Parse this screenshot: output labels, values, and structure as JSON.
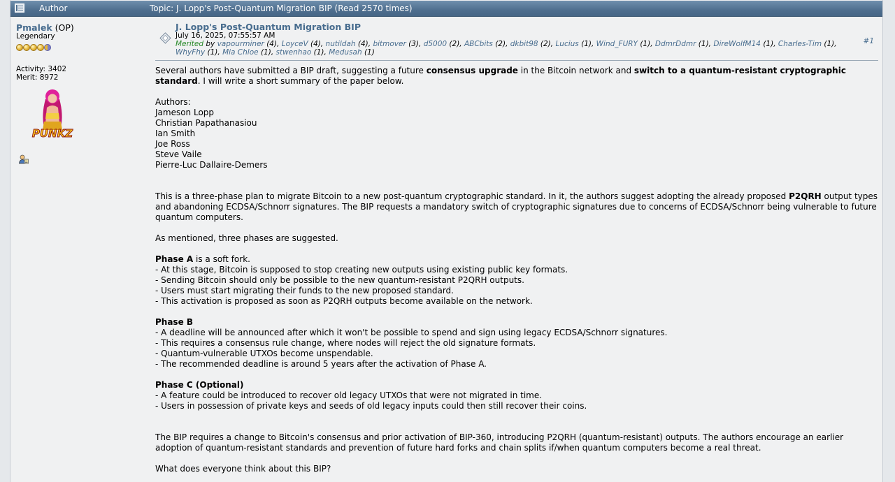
{
  "header": {
    "author_label": "Author",
    "topic_label": "Topic: J. Lopp's Post-Quantum Migration BIP  (Read 2570 times)"
  },
  "poster": {
    "name": "Pmalek",
    "op": " (OP)",
    "rank": "Legendary",
    "activity": "Activity: 3402",
    "merit": "Merit: 8972"
  },
  "post": {
    "title": "J. Lopp's Post-Quantum Migration BIP",
    "date": "July 16, 2025, 07:55:57 AM",
    "merited_label": "Merited",
    "merited_by": " by ",
    "merits": [
      {
        "name": "vapourminer",
        "count": " (4), "
      },
      {
        "name": "LoyceV",
        "count": " (4), "
      },
      {
        "name": "nutildah",
        "count": " (4), "
      },
      {
        "name": "bitmover",
        "count": " (3), "
      },
      {
        "name": "d5000",
        "count": " (2), "
      },
      {
        "name": "ABCbits",
        "count": " (2), "
      },
      {
        "name": "dkbit98",
        "count": " (2), "
      },
      {
        "name": "Lucius",
        "count": " (1), "
      },
      {
        "name": "Wind_FURY",
        "count": " (1), "
      },
      {
        "name": "DdmrDdmr",
        "count": " (1), "
      },
      {
        "name": "DireWolfM14",
        "count": " (1), "
      },
      {
        "name": "Charles-Tim",
        "count": " (1), "
      },
      {
        "name": "WhyFhy",
        "count": " (1), "
      },
      {
        "name": "Mia Chloe",
        "count": " (1), "
      },
      {
        "name": "stwenhao",
        "count": " (1), "
      },
      {
        "name": "Medusah",
        "count": " (1)"
      }
    ],
    "number": "#1"
  },
  "content": {
    "intro_a": "Several authors have submitted a BIP draft, suggesting a future ",
    "intro_b": "consensus upgrade",
    "intro_c": " in the Bitcoin network and ",
    "intro_d": "switch to a quantum-resistant cryptographic standard",
    "intro_e": ". I will write a short summary of the paper below.",
    "authors_label": "Authors:",
    "authors": [
      "Jameson Lopp",
      "Christian Papathanasiou",
      "Ian Smith",
      "Joe Ross",
      "Steve Vaile",
      "Pierre-Luc Dallaire-Demers"
    ],
    "plan_a": "This is a three-phase plan to migrate Bitcoin to a new post-quantum cryptographic standard. In it, the authors suggest adopting the already proposed ",
    "plan_b": "P2QRH",
    "plan_c": " output types and abandoning ECDSA/Schnorr signatures. The BIP requests a mandatory switch of cryptographic signatures due to concerns of ECDSA/Schnorr being vulnerable to future quantum computers.",
    "mentioned": "As mentioned, three phases are suggested.",
    "phase_a_title": "Phase A",
    "phase_a_rest": " is a soft fork.",
    "phase_a_items": [
      "- At this stage, Bitcoin is supposed to stop creating new outputs using existing public key formats.",
      "- Sending Bitcoin should only be possible to the new quantum-resistant P2QRH outputs.",
      "- Users must start migrating their funds to the new proposed standard.",
      "- This activation is proposed as soon as P2QRH outputs become available on the network."
    ],
    "phase_b_title": "Phase B",
    "phase_b_items": [
      "- A deadline will be announced after which it won't be possible to spend and sign using legacy ECDSA/Schnorr signatures.",
      "- This requires a consensus rule change, where nodes will reject the old signature formats.",
      "- Quantum-vulnerable UTXOs become unspendable.",
      "- The recommended deadline is around 5 years after the activation of Phase A."
    ],
    "phase_c_title": "Phase C (Optional)",
    "phase_c_items": [
      "- A feature could be introduced to recover old legacy UTXOs that were not migrated in time.",
      "- Users in possession of private keys and seeds of old legacy inputs could then still recover their coins."
    ],
    "closing": "The BIP requires a change to Bitcoin's consensus and prior activation of BIP-360, introducing P2QRH (quantum-resistant) outputs. The authors encourage an earlier adoption of quantum-resistant standards and prevention of future hard forks and chain splits if/when quantum computers become a real threat.",
    "question": "What does everyone think about this BIP?"
  }
}
